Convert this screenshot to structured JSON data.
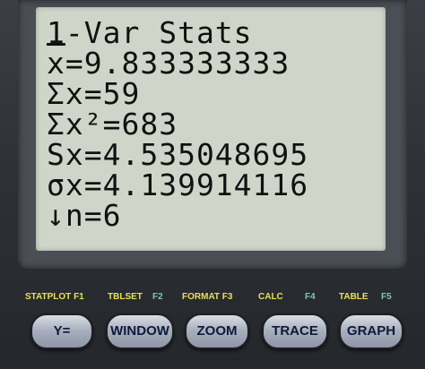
{
  "screen": {
    "lines": [
      "1-Var Stats",
      "̅x=9.833333333",
      "Σx=59",
      "Σx²=683",
      "Sx=4.535048695",
      "σx=4.139914116",
      "↓n=6"
    ],
    "line1": "1-Var Stats",
    "line2_prefix": "x",
    "line2_rest": "=9.833333333",
    "line3": "Σx=59",
    "line4": "Σx²=683",
    "line5": "Sx=4.535048695",
    "line6": "σx=4.139914116",
    "line7": "↓n=6"
  },
  "key_labels": {
    "statplot": "STATPLOT F1",
    "tblset": "TBLSET",
    "f2": "F2",
    "format": "FORMAT F3",
    "calc": "CALC",
    "f4": "F4",
    "table": "TABLE",
    "f5": "F5"
  },
  "keys": {
    "y_equals": "Y=",
    "window": "WINDOW",
    "zoom": "ZOOM",
    "trace": "TRACE",
    "graph": "GRAPH"
  },
  "colors": {
    "screen_bg": "#cfd6c9",
    "key_face": "#a9b0bf",
    "label_yellow": "#e7e05a",
    "label_green": "#78c9b0"
  }
}
